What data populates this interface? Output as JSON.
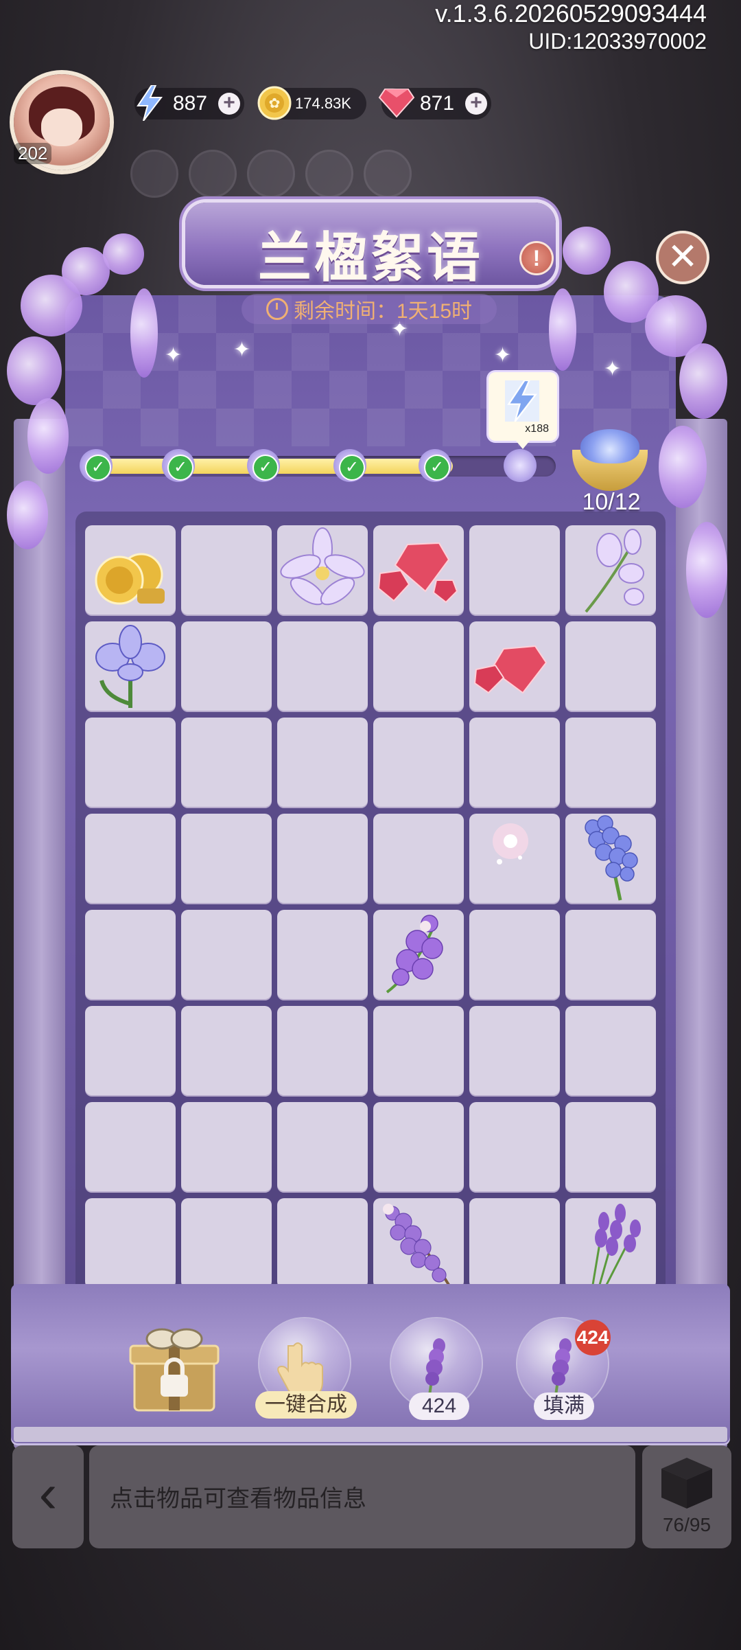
{
  "version": {
    "build": "v.1.3.6.20260529093444",
    "uid": "UID:12033970002"
  },
  "player": {
    "level": "202"
  },
  "resources": {
    "energy": "887",
    "gold": "174.83K",
    "gems": "871"
  },
  "event": {
    "title": "兰楹絮语",
    "timer_label": "剩余时间：1天15时"
  },
  "progress": {
    "current": 10,
    "total": 12,
    "label": "10/12",
    "reward_qty": "x188",
    "completed_nodes": 5
  },
  "board": {
    "rows": 8,
    "cols": 6,
    "items": [
      {
        "row": 0,
        "col": 0,
        "icon": "gold-coins-icon"
      },
      {
        "row": 0,
        "col": 2,
        "icon": "lily-flower-icon"
      },
      {
        "row": 0,
        "col": 3,
        "icon": "ruby-gems-icon"
      },
      {
        "row": 0,
        "col": 5,
        "icon": "freesia-flower-icon"
      },
      {
        "row": 1,
        "col": 0,
        "icon": "iris-flower-icon"
      },
      {
        "row": 1,
        "col": 4,
        "icon": "ruby-gem-icon"
      },
      {
        "row": 3,
        "col": 4,
        "icon": "sparkle-effect-icon"
      },
      {
        "row": 3,
        "col": 5,
        "icon": "hyacinth-flower-icon"
      },
      {
        "row": 4,
        "col": 3,
        "icon": "violet-bouquet-icon"
      },
      {
        "row": 7,
        "col": 3,
        "icon": "lilac-branch-icon"
      },
      {
        "row": 7,
        "col": 5,
        "icon": "lavender-bunch-icon"
      }
    ]
  },
  "actions": {
    "merge_all": "一键合成",
    "lavender_count": "424",
    "fill": "填满",
    "fill_badge": "424"
  },
  "footer": {
    "hint": "点击物品可查看物品信息",
    "storage": "76/95"
  },
  "colors": {
    "panel": "#7c69b4",
    "cell": "#d9d2e4",
    "progress_fill": "#f3d45c",
    "check": "#3cb54a",
    "timer_text": "#f0b073",
    "badge": "#d94336"
  }
}
